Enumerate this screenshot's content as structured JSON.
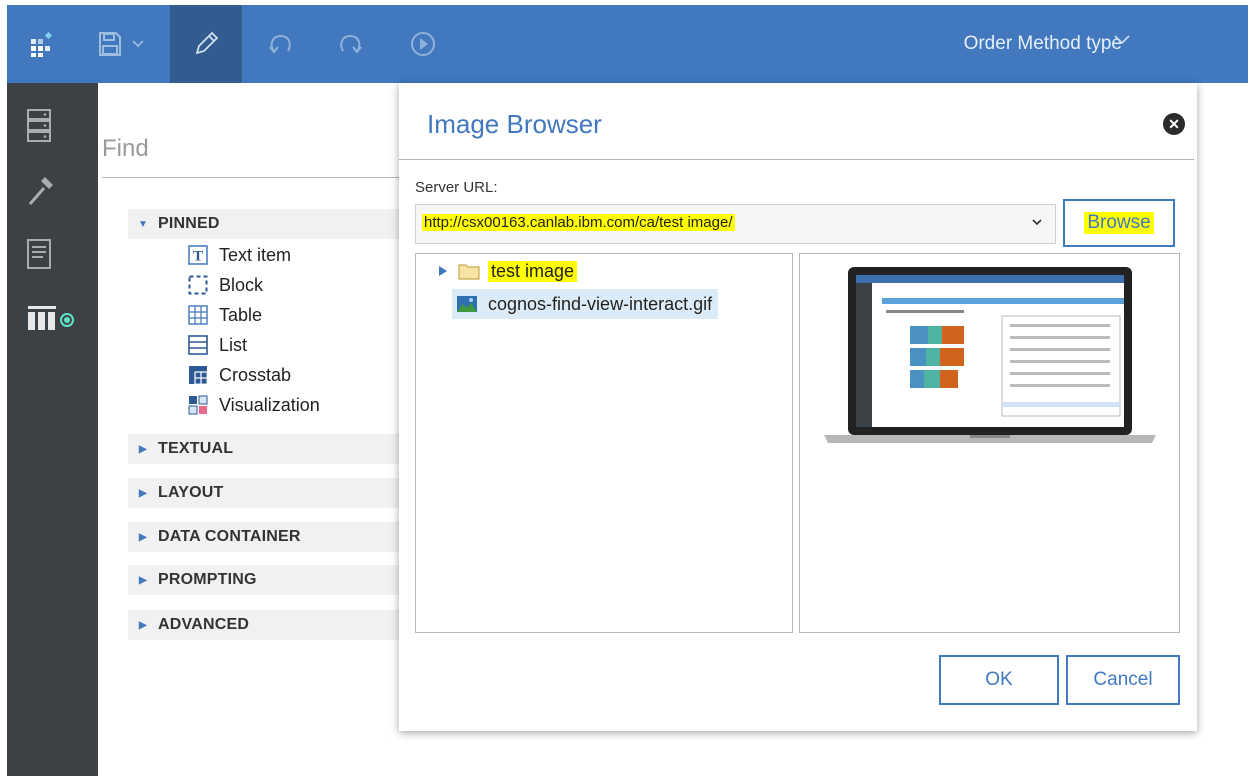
{
  "toolbar": {
    "title": "Order Method type",
    "icons": [
      "app-grid-icon",
      "save-icon",
      "chevron-down-icon",
      "edit-pencil-icon",
      "undo-icon",
      "redo-icon",
      "run-play-icon"
    ]
  },
  "rail": {
    "icons": [
      "data-storage-icon",
      "tools-hammer-icon",
      "report-page-icon",
      "toolbox-icon"
    ]
  },
  "panel": {
    "search_placeholder": "Find",
    "pinned": {
      "label": "PINNED",
      "items": [
        {
          "label": "Text item",
          "icon": "text-item-icon"
        },
        {
          "label": "Block",
          "icon": "block-icon"
        },
        {
          "label": "Table",
          "icon": "table-icon"
        },
        {
          "label": "List",
          "icon": "list-icon"
        },
        {
          "label": "Crosstab",
          "icon": "crosstab-icon"
        },
        {
          "label": "Visualization",
          "icon": "visualization-icon"
        }
      ]
    },
    "sections": [
      {
        "label": "TEXTUAL"
      },
      {
        "label": "LAYOUT"
      },
      {
        "label": "DATA CONTAINER"
      },
      {
        "label": "PROMPTING"
      },
      {
        "label": "ADVANCED"
      }
    ]
  },
  "dialog": {
    "title": "Image Browser",
    "server_url_label": "Server URL:",
    "server_url_value": "http://csx00163.canlab.ibm.com/ca/test image/",
    "browse_label": "Browse",
    "tree": [
      {
        "label": "test image",
        "type": "folder"
      },
      {
        "label": "cognos-find-view-interact.gif",
        "type": "image"
      }
    ],
    "ok_label": "OK",
    "cancel_label": "Cancel"
  },
  "colors": {
    "toolbar": "#4178be",
    "toolbar_active": "#325c8f",
    "rail": "#3c4146",
    "accent": "#4178be",
    "highlight": "#ffff00",
    "selection": "#dbecf8"
  }
}
